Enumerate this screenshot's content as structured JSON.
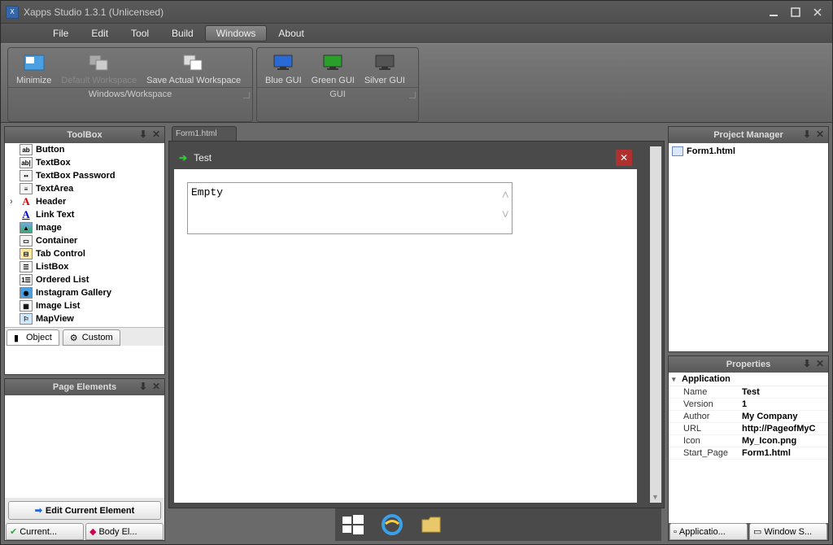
{
  "title": "Xapps Studio 1.3.1 (Unlicensed)",
  "menu": [
    "File",
    "Edit",
    "Tool",
    "Build",
    "Windows",
    "About"
  ],
  "menu_active_index": 4,
  "ribbon": {
    "groups": [
      {
        "title": "Windows/Workspace",
        "items": [
          {
            "label": "Minimize",
            "icon": "minimize",
            "disabled": false
          },
          {
            "label": "Default Workspace",
            "icon": "workspace",
            "disabled": true
          },
          {
            "label": "Save Actual Workspace",
            "icon": "workspace-save",
            "disabled": false
          }
        ]
      },
      {
        "title": "GUI",
        "items": [
          {
            "label": "Blue GUI",
            "icon": "monitor-blue",
            "color": "#2a6ad6"
          },
          {
            "label": "Green GUI",
            "icon": "monitor-green",
            "color": "#2aa02a"
          },
          {
            "label": "Silver GUI",
            "icon": "monitor-silver",
            "color": "#555"
          }
        ]
      }
    ]
  },
  "toolbox": {
    "title": "ToolBox",
    "items": [
      {
        "label": "Button",
        "icon": "ab"
      },
      {
        "label": "TextBox",
        "icon": "abI"
      },
      {
        "label": "TextBox Password",
        "icon": "**"
      },
      {
        "label": "TextArea",
        "icon": "ta"
      },
      {
        "label": "Header",
        "icon": "A",
        "expandable": true
      },
      {
        "label": "Link Text",
        "icon": "A"
      },
      {
        "label": "Image",
        "icon": "img"
      },
      {
        "label": "Container",
        "icon": "[]"
      },
      {
        "label": "Tab Control",
        "icon": "tab"
      },
      {
        "label": "ListBox",
        "icon": "lst"
      },
      {
        "label": "Ordered List",
        "icon": "ol"
      },
      {
        "label": "Instagram Gallery",
        "icon": "ig"
      },
      {
        "label": "Image List",
        "icon": "il"
      },
      {
        "label": "MapView",
        "icon": "map"
      }
    ],
    "tabs": [
      {
        "label": "Object",
        "active": true
      },
      {
        "label": "Custom",
        "active": false
      }
    ]
  },
  "page_elements": {
    "title": "Page Elements",
    "edit_button": "Edit Current Element",
    "tabs": [
      {
        "label": "Current..."
      },
      {
        "label": "Body El..."
      }
    ]
  },
  "form": {
    "tab": "Form1.html",
    "window_title": "Test",
    "textarea_value": "Empty"
  },
  "project_manager": {
    "title": "Project Manager",
    "items": [
      {
        "label": "Form1.html"
      }
    ]
  },
  "properties": {
    "title": "Properties",
    "section": "Application",
    "rows": [
      {
        "k": "Name",
        "v": "Test"
      },
      {
        "k": "Version",
        "v": "1"
      },
      {
        "k": "Author",
        "v": "My Company"
      },
      {
        "k": "URL",
        "v": "http://PageofMyC"
      },
      {
        "k": "Icon",
        "v": "My_Icon.png"
      },
      {
        "k": "Start_Page",
        "v": "Form1.html"
      }
    ],
    "tabs": [
      {
        "label": "Applicatio..."
      },
      {
        "label": "Window S..."
      }
    ]
  }
}
